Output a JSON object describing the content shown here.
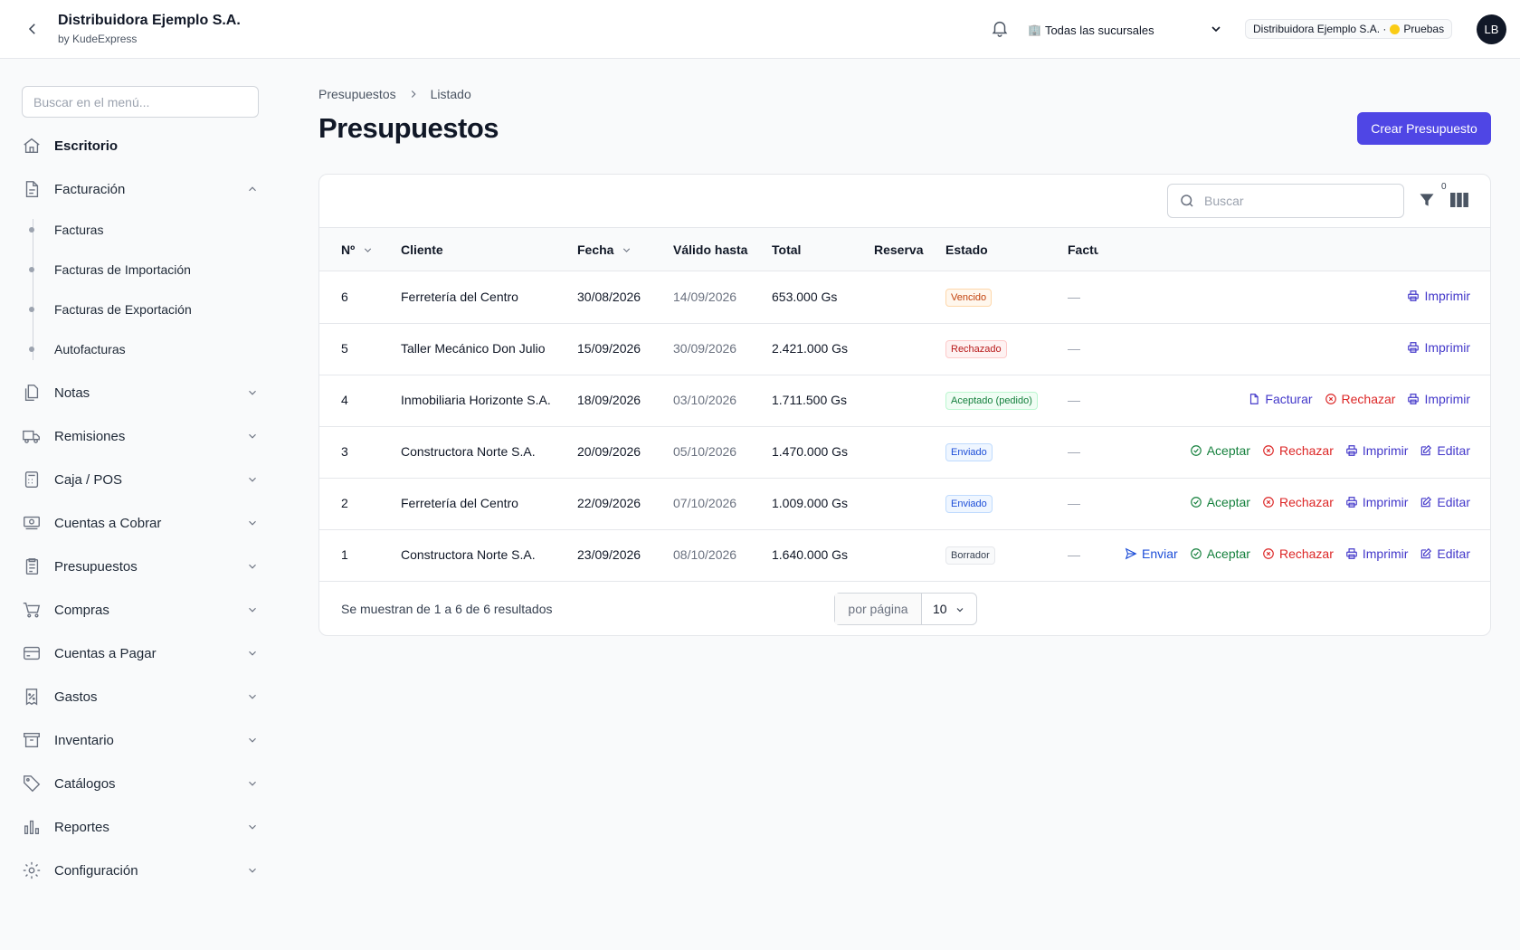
{
  "header": {
    "brand_title": "Distribuidora Ejemplo S.A.",
    "brand_sub": "by KudeExpress",
    "branch_icon": "🏢",
    "branch_label": "Todas las sucursales",
    "company_name": "Distribuidora Ejemplo S.A. ·",
    "environment": "Pruebas",
    "avatar_initials": "LB"
  },
  "sidebar": {
    "search_placeholder": "Buscar en el menú...",
    "items": {
      "escritorio": "Escritorio",
      "facturacion": "Facturación",
      "notas": "Notas",
      "remisiones": "Remisiones",
      "caja": "Caja / POS",
      "cobrar": "Cuentas a Cobrar",
      "presupuestos": "Presupuestos",
      "compras": "Compras",
      "pagar": "Cuentas a Pagar",
      "gastos": "Gastos",
      "inventario": "Inventario",
      "catalogos": "Catálogos",
      "reportes": "Reportes",
      "configuracion": "Configuración"
    },
    "facturacion_sub": {
      "facturas": "Facturas",
      "importacion": "Facturas de Importación",
      "exportacion": "Facturas de Exportación",
      "autofacturas": "Autofacturas"
    }
  },
  "main": {
    "breadcrumb_root": "Presupuestos",
    "breadcrumb_current": "Listado",
    "title": "Presupuestos",
    "create_button": "Crear Presupuesto",
    "search_placeholder": "Buscar",
    "filter_count": "0",
    "columns": {
      "num": "Nº",
      "cliente": "Cliente",
      "fecha": "Fecha",
      "valido": "Válido hasta",
      "total": "Total",
      "reserva": "Reserva",
      "estado": "Estado",
      "factura": "Factura"
    },
    "rows": [
      {
        "num": "6",
        "cliente": "Ferretería del Centro",
        "fecha": "30/08/2026",
        "valido": "14/09/2026",
        "total": "653.000 Gs",
        "estado": "Vencido",
        "factura": "—"
      },
      {
        "num": "5",
        "cliente": "Taller Mecánico Don Julio",
        "fecha": "15/09/2026",
        "valido": "30/09/2026",
        "total": "2.421.000 Gs",
        "estado": "Rechazado",
        "factura": "—"
      },
      {
        "num": "4",
        "cliente": "Inmobiliaria Horizonte S.A.",
        "fecha": "18/09/2026",
        "valido": "03/10/2026",
        "total": "1.711.500 Gs",
        "estado": "Aceptado (pedido)",
        "factura": "—"
      },
      {
        "num": "3",
        "cliente": "Constructora Norte S.A.",
        "fecha": "20/09/2026",
        "valido": "05/10/2026",
        "total": "1.470.000 Gs",
        "estado": "Enviado",
        "factura": "—"
      },
      {
        "num": "2",
        "cliente": "Ferretería del Centro",
        "fecha": "22/09/2026",
        "valido": "07/10/2026",
        "total": "1.009.000 Gs",
        "estado": "Enviado",
        "factura": "—"
      },
      {
        "num": "1",
        "cliente": "Constructora Norte S.A.",
        "fecha": "23/09/2026",
        "valido": "08/10/2026",
        "total": "1.640.000 Gs",
        "estado": "Borrador",
        "factura": "—"
      }
    ],
    "actions": {
      "imprimir": "Imprimir",
      "facturar": "Facturar",
      "rechazar": "Rechazar",
      "aceptar": "Aceptar",
      "editar": "Editar",
      "enviar": "Enviar"
    },
    "footer_text": "Se muestran de 1 a 6 de 6 resultados",
    "per_page_label": "por página",
    "per_page_value": "10"
  },
  "colors": {
    "accent": "#4f46e5",
    "vencido": "#c2410c",
    "rechazado": "#b91c1c",
    "aceptado": "#15803d",
    "enviado": "#1d4ed8",
    "borrador": "#374151"
  }
}
